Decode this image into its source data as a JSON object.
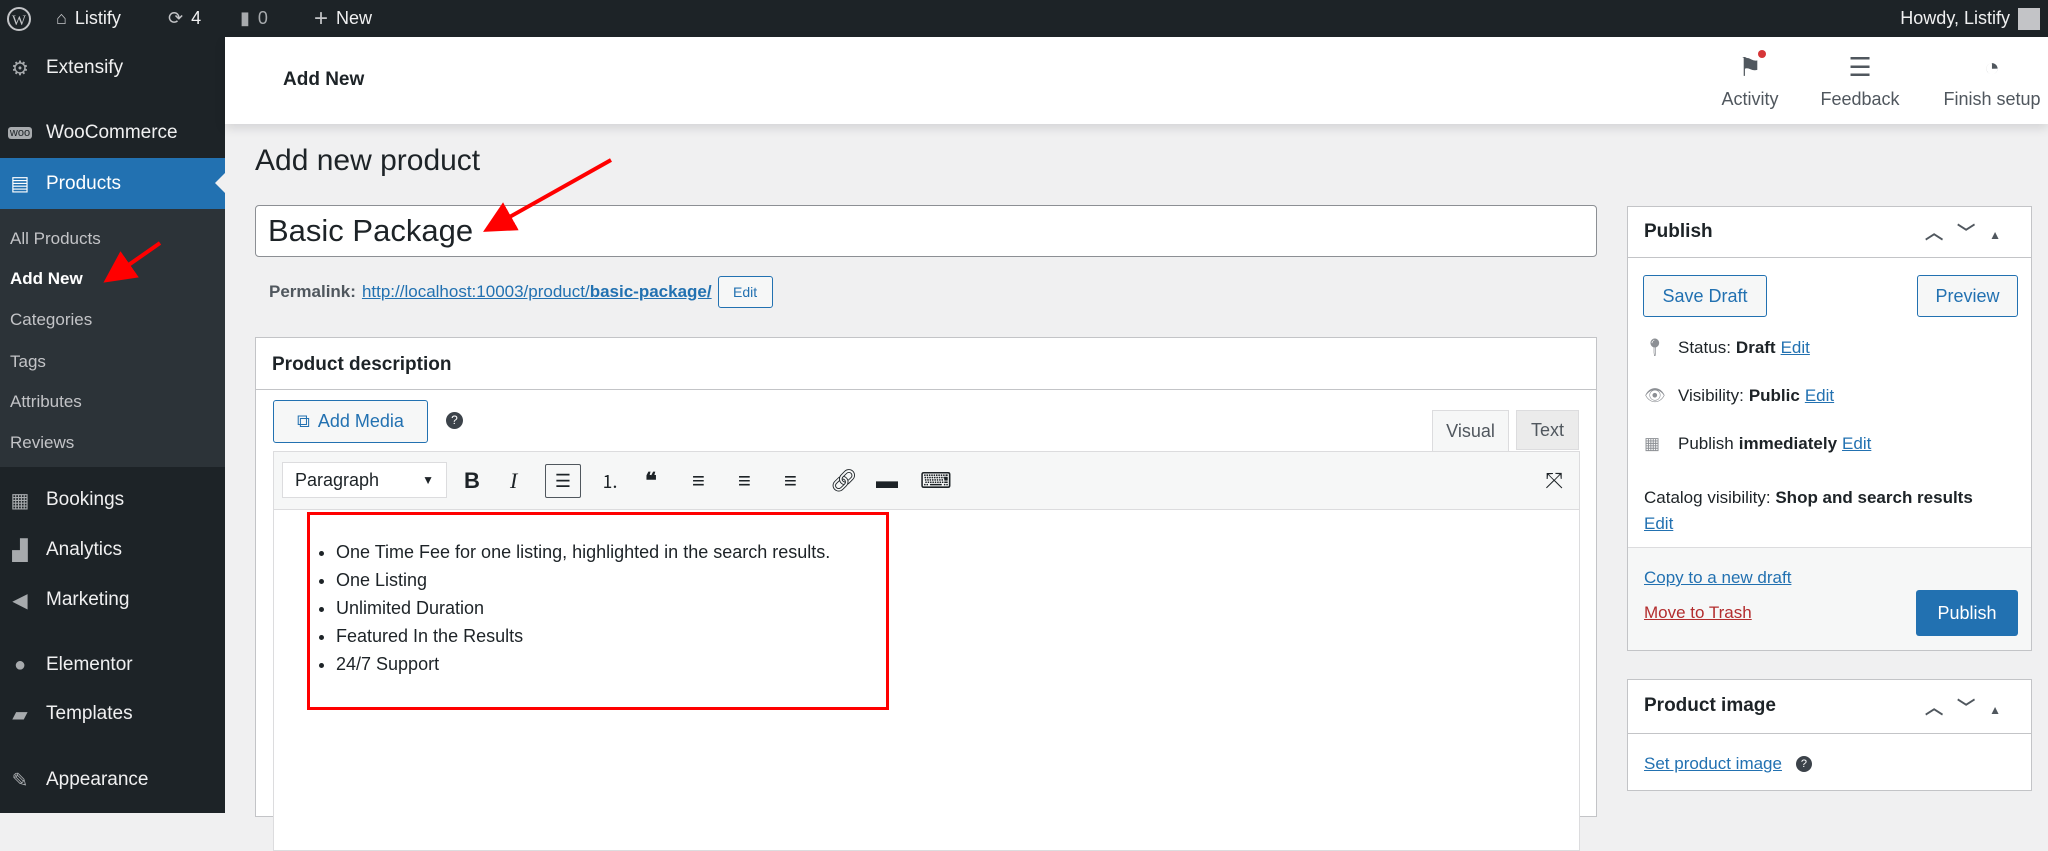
{
  "adminbar": {
    "site": "Listify",
    "updates": "4",
    "comments": "0",
    "new": "New",
    "howdy": "Howdy, Listify"
  },
  "sidebar": {
    "items": [
      {
        "label": "Extensify",
        "icon": "gear-icon"
      },
      {
        "label": "WooCommerce",
        "icon": "woo-icon"
      },
      {
        "label": "Products",
        "icon": "archive-icon"
      },
      {
        "label": "Bookings",
        "icon": "calendar-icon"
      },
      {
        "label": "Analytics",
        "icon": "bar-chart-icon"
      },
      {
        "label": "Marketing",
        "icon": "megaphone-icon"
      },
      {
        "label": "Elementor",
        "icon": "elementor-icon"
      },
      {
        "label": "Templates",
        "icon": "folder-icon"
      },
      {
        "label": "Appearance",
        "icon": "brush-icon"
      }
    ],
    "submenu": [
      "All Products",
      "Add New",
      "Categories",
      "Tags",
      "Attributes",
      "Reviews"
    ]
  },
  "header": {
    "title": "Add New",
    "activity": "Activity",
    "feedback": "Feedback",
    "finish": "Finish setup"
  },
  "page": {
    "title": "Add new product",
    "product_title": "Basic Package",
    "permalink_label": "Permalink:",
    "permalink_base": "http://localhost:10003/product/",
    "permalink_slug": "basic-package/",
    "edit": "Edit"
  },
  "description": {
    "heading": "Product description",
    "add_media": "Add Media",
    "tab_visual": "Visual",
    "tab_text": "Text",
    "format": "Paragraph",
    "items": [
      "One Time Fee for one listing, highlighted in the search results.",
      "One Listing",
      "Unlimited Duration",
      "Featured In the Results",
      "24/7 Support"
    ]
  },
  "publish": {
    "heading": "Publish",
    "save_draft": "Save Draft",
    "preview": "Preview",
    "status_label": "Status:",
    "status": "Draft",
    "visibility_label": "Visibility:",
    "visibility": "Public",
    "publish_label": "Publish",
    "publish_when": "immediately",
    "catalog_label": "Catalog visibility:",
    "catalog": "Shop and search results",
    "edit": "Edit",
    "copy": "Copy to a new draft",
    "trash": "Move to Trash",
    "publish_btn": "Publish"
  },
  "product_image": {
    "heading": "Product image",
    "set": "Set product image"
  },
  "colors": {
    "accent": "#2271b1",
    "sidebar": "#1d2327",
    "annotation": "#ff0000",
    "trash": "#b32d2e"
  }
}
